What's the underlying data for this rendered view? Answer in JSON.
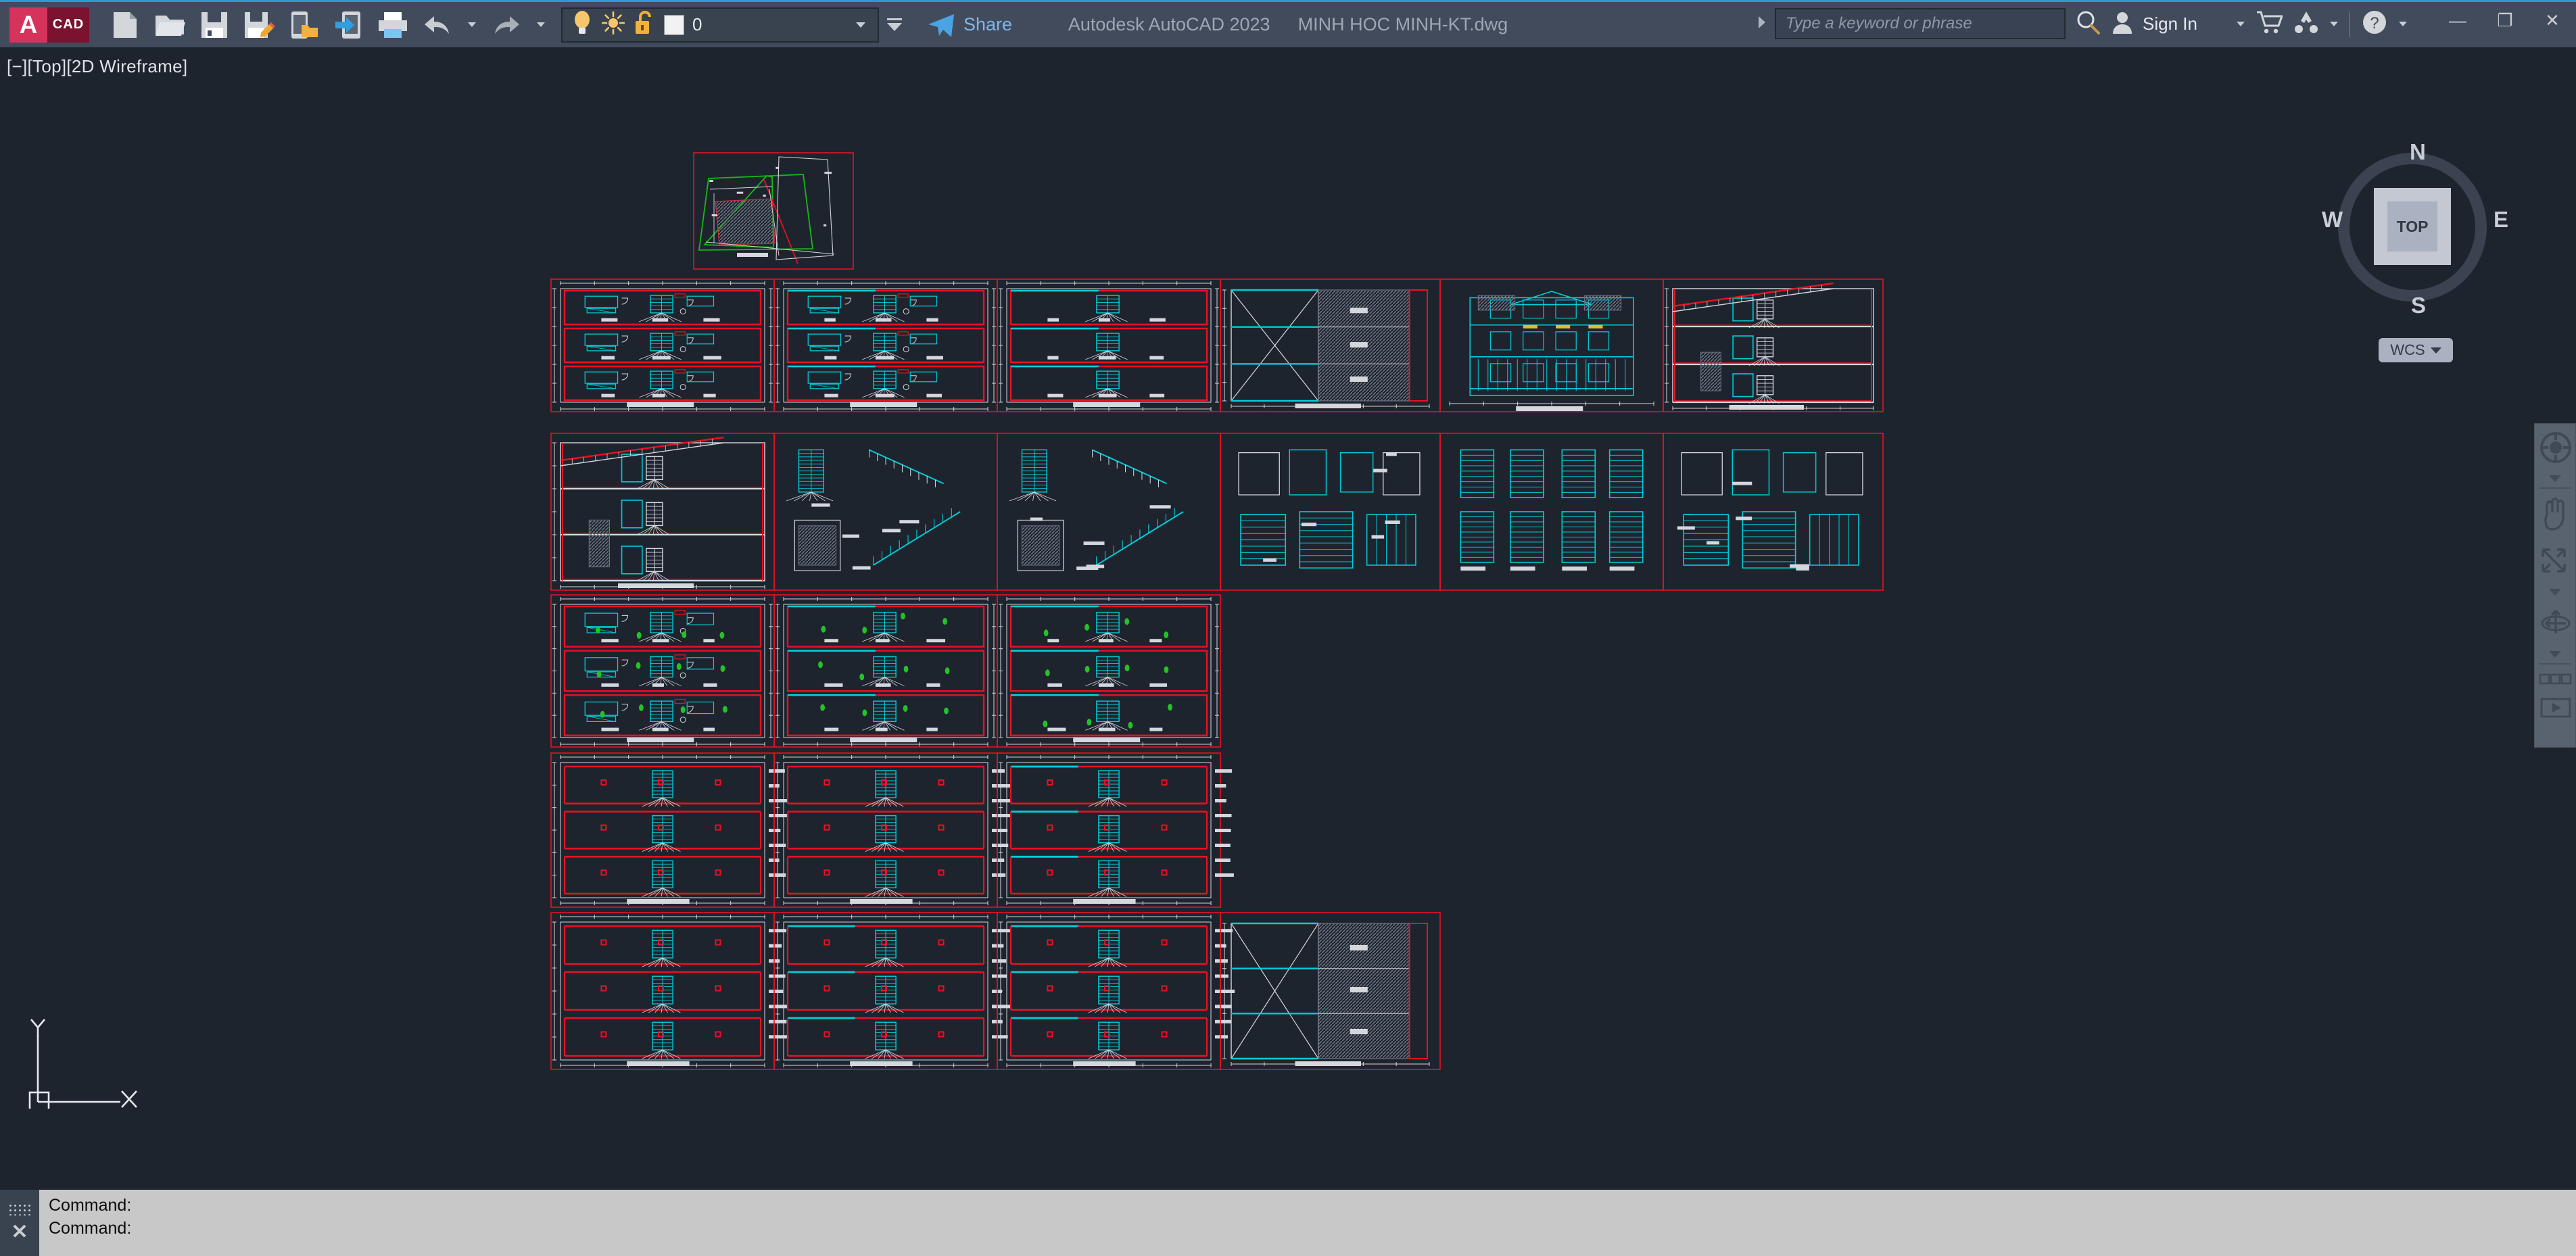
{
  "app": {
    "title_product": "Autodesk AutoCAD 2023",
    "title_file": "MINH HOC MINH-KT.dwg",
    "accent_blue": "#2c9ad1",
    "titlebar_bg": "#414b5c",
    "canvas_bg": "#1e242e"
  },
  "quick_access": {
    "items": [
      {
        "name": "new-icon",
        "label": "New"
      },
      {
        "name": "open-icon",
        "label": "Open"
      },
      {
        "name": "save-icon",
        "label": "Save"
      },
      {
        "name": "saveas-icon",
        "label": "Save As"
      },
      {
        "name": "open-web-icon",
        "label": "Open from Web & Mobile"
      },
      {
        "name": "save-web-icon",
        "label": "Save to Web & Mobile"
      },
      {
        "name": "plot-icon",
        "label": "Plot"
      },
      {
        "name": "undo-icon",
        "label": "Undo"
      },
      {
        "name": "redo-icon",
        "label": "Redo"
      }
    ]
  },
  "layer_control": {
    "layer_name": "0",
    "on_icon": "lightbulb-icon",
    "freeze_icon": "sun-icon",
    "lock_icon": "unlock-icon",
    "color_swatch": "#f2f2f2",
    "dropdown_icon": "chevron-down-icon"
  },
  "share": {
    "label": "Share",
    "icon": "paper-plane-icon",
    "color": "#7eb6e8"
  },
  "search": {
    "placeholder": "Type a keyword or phrase",
    "icon": "search-icon",
    "expand_icon": "chevron-right-icon"
  },
  "account": {
    "sign_in_label": "Sign In",
    "avatar_icon": "user-icon",
    "dropdown_icon": "chevron-down-icon",
    "cart_icon": "shopping-cart-icon",
    "autodesk_icon": "autodesk-logo-icon",
    "help_icon": "help-question-icon"
  },
  "window_controls": {
    "minimize": "—",
    "maximize": "❐",
    "close": "✕"
  },
  "viewport": {
    "label": "[−][Top][2D Wireframe]",
    "view_name": "Top",
    "visual_style": "2D Wireframe"
  },
  "viewcube": {
    "top_face": "TOP",
    "north": "N",
    "east": "E",
    "south": "S",
    "west": "W",
    "ucs_label": "WCS"
  },
  "navbar": {
    "items": [
      {
        "name": "steering-wheel-icon",
        "label": "Full Navigation Wheel"
      },
      {
        "name": "pan-hand-icon",
        "label": "Pan"
      },
      {
        "name": "zoom-extents-icon",
        "label": "Zoom Extents"
      },
      {
        "name": "orbit-icon",
        "label": "Orbit"
      },
      {
        "name": "showmotion-icon",
        "label": "ShowMotion"
      }
    ]
  },
  "ucs_icon": {
    "x_label": "X",
    "y_label": "Y",
    "type": "2d-ucs-icon"
  },
  "command_window": {
    "lines": [
      "Command:",
      "Command:"
    ],
    "close_icon": "close-icon",
    "grip_icon": "drag-grip-icon"
  },
  "drawing": {
    "description": "Architectural drawing set — multi-storey house, plans, sections and elevations arranged in red sheet frames",
    "frame_color": "#e81123",
    "wall_color": "#e81123",
    "fixture_color": "#00cdd7",
    "annotation_color": "#d4d8de",
    "vegetation_color": "#22c425",
    "boundary_color": "#15b915",
    "hatch_color": "#6c7280",
    "grid": {
      "rows": [
        {
          "row": 1,
          "cells": 6,
          "kind": "floor-plan-row"
        },
        {
          "row": 2,
          "cells": 6,
          "kind": "detail-row"
        },
        {
          "row": 3,
          "cells": 3,
          "kind": "landscape-plan-row"
        },
        {
          "row": 4,
          "cells": 3,
          "kind": "structural-plan-row"
        },
        {
          "row": 5,
          "cells": 4,
          "kind": "foundation-plan-row"
        }
      ],
      "site_plan_above": true
    }
  }
}
